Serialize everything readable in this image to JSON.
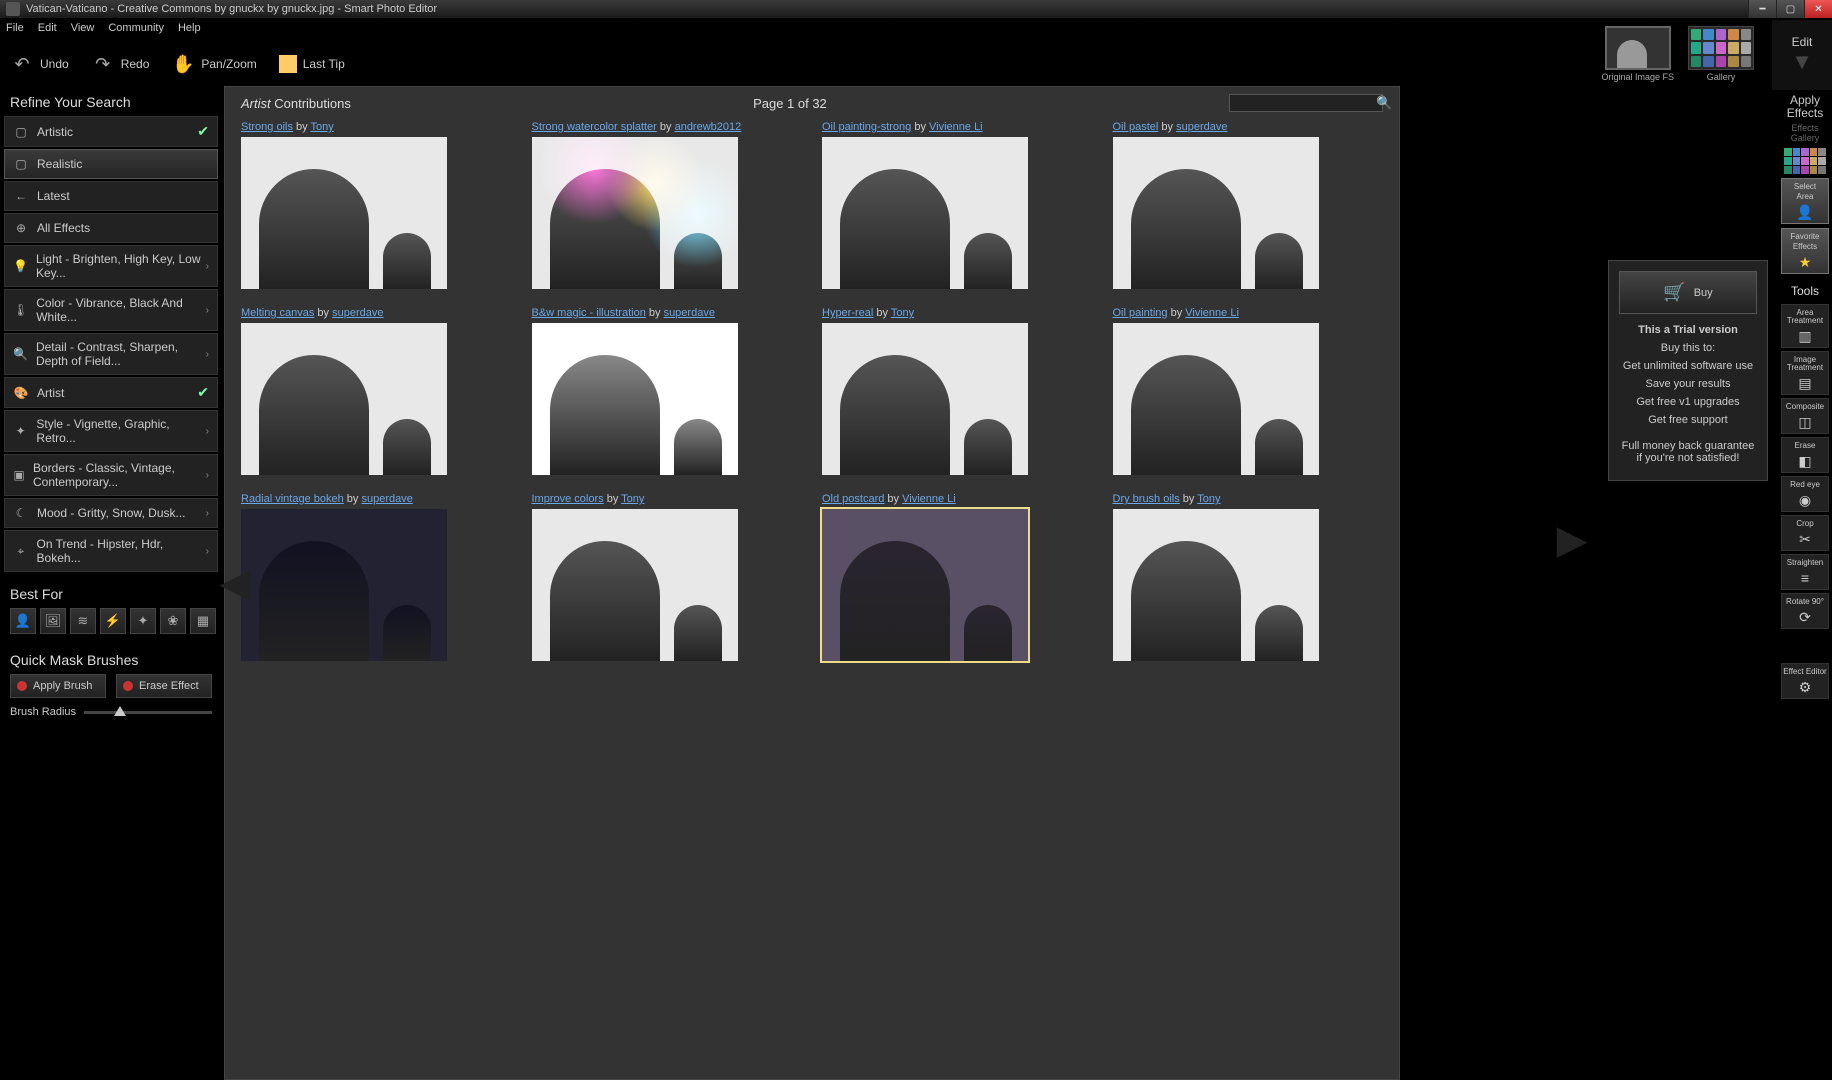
{
  "window": {
    "title": "Vatican-Vaticano - Creative Commons by gnuckx by gnuckx.jpg - Smart Photo Editor"
  },
  "menu": {
    "file": "File",
    "edit": "Edit",
    "view": "View",
    "community": "Community",
    "help": "Help"
  },
  "toolbar": {
    "undo": "Undo",
    "redo": "Redo",
    "panzoom": "Pan/Zoom",
    "lasttip": "Last Tip"
  },
  "topthumbs": {
    "original": "Original Image FS",
    "gallery": "Gallery",
    "edit": "Edit"
  },
  "sidebar": {
    "refine_header": "Refine Your Search",
    "items": [
      {
        "label": "Artistic",
        "checked": true
      },
      {
        "label": "Realistic",
        "active": true
      },
      {
        "label": "Latest"
      },
      {
        "label": "All Effects"
      },
      {
        "label": "Light - Brighten, High Key, Low Key...",
        "chev": true
      },
      {
        "label": "Color - Vibrance, Black And White...",
        "chev": true
      },
      {
        "label": "Detail - Contrast, Sharpen, Depth of Field...",
        "chev": true
      },
      {
        "label": "Artist",
        "checked": true
      },
      {
        "label": "Style - Vignette, Graphic, Retro...",
        "chev": true
      },
      {
        "label": "Borders - Classic, Vintage, Contemporary...",
        "chev": true
      },
      {
        "label": "Mood - Gritty, Snow, Dusk...",
        "chev": true
      },
      {
        "label": "On Trend - Hipster, Hdr, Bokeh...",
        "chev": true
      }
    ],
    "bestfor_header": "Best For",
    "qmb_header": "Quick Mask Brushes",
    "apply_brush": "Apply Brush",
    "erase_effect": "Erase Effect",
    "brush_radius": "Brush Radius"
  },
  "gallery": {
    "header_prefix": "Artist",
    "header_rest": " Contributions",
    "page_label": "Page 1 of 32",
    "search_placeholder": "",
    "cells": [
      {
        "title": "Strong oils",
        "by": "by",
        "author": "Tony"
      },
      {
        "title": "Strong watercolor splatter",
        "by": "by",
        "author": "andrewb2012",
        "splat": true
      },
      {
        "title": "Oil painting-strong",
        "by": "by",
        "author": "Vivienne Li"
      },
      {
        "title": "Oil pastel",
        "by": "by",
        "author": "superdave"
      },
      {
        "title": "Melting canvas",
        "by": "by",
        "author": "superdave"
      },
      {
        "title": "B&w magic - illustration",
        "by": "by",
        "author": "superdave",
        "white": true
      },
      {
        "title": "Hyper-real",
        "by": "by",
        "author": "Tony"
      },
      {
        "title": "Oil painting",
        "by": "by",
        "author": "Vivienne Li"
      },
      {
        "title": "Radial vintage bokeh",
        "by": "by",
        "author": "superdave",
        "dark": true
      },
      {
        "title": "Improve colors",
        "by": "by",
        "author": "Tony"
      },
      {
        "title": "Old postcard",
        "by": "by",
        "author": "Vivienne Li",
        "sel": true,
        "sepia": true
      },
      {
        "title": "Dry brush oils",
        "by": "by",
        "author": "Tony"
      }
    ]
  },
  "trial": {
    "buy": "Buy",
    "line1": "This a Trial version",
    "line2": "Buy this to:",
    "l3": "Get unlimited software use",
    "l4": "Save your results",
    "l5": "Get free v1 upgrades",
    "l6": "Get free support",
    "l7": "Full money back guarantee if you're not satisfied!"
  },
  "right": {
    "apply1": "Apply",
    "apply2": "Effects",
    "effects_gallery1": "Effects",
    "effects_gallery2": "Gallery",
    "select_area1": "Select",
    "select_area2": "Area",
    "fav1": "Favorite",
    "fav2": "Effects",
    "tools_header": "Tools",
    "tools": [
      "Area Treatment",
      "Image Treatment",
      "Composite",
      "Erase",
      "Red eye",
      "Crop",
      "Straighten",
      "Rotate 90°"
    ],
    "effect_editor": "Effect Editor"
  },
  "palette_colors": [
    "#3a7",
    "#48c",
    "#a6c",
    "#c84",
    "#888",
    "#2a8",
    "#68c",
    "#c6c",
    "#ca6",
    "#aaa",
    "#286",
    "#46a",
    "#a4a",
    "#a84",
    "#777"
  ]
}
